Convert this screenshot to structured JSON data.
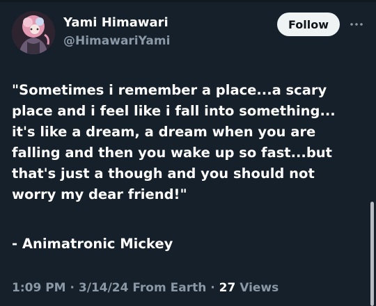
{
  "header": {
    "display_name": "Yami Himawari",
    "handle": "@HimawariYami",
    "follow_label": "Follow",
    "more_icon": "more-horizontal-icon"
  },
  "tweet": {
    "lines": [
      "\"Sometimes i remember a place...a scary",
      "place and i feel like i fall into something...",
      "it's like a dream, a dream when you are",
      "falling and then you wake up so fast...but",
      "that's just a though and you should not",
      "worry my dear friend!\""
    ],
    "signature": "- Animatronic Mickey"
  },
  "meta": {
    "time": "1:09 PM",
    "date": "3/14/24",
    "location": "From Earth",
    "views_count": "27",
    "views_label": "Views",
    "separator": "·"
  },
  "colors": {
    "background": "#15202b",
    "secondary_text": "#8b98a5",
    "button_bg": "#eff3f4"
  }
}
